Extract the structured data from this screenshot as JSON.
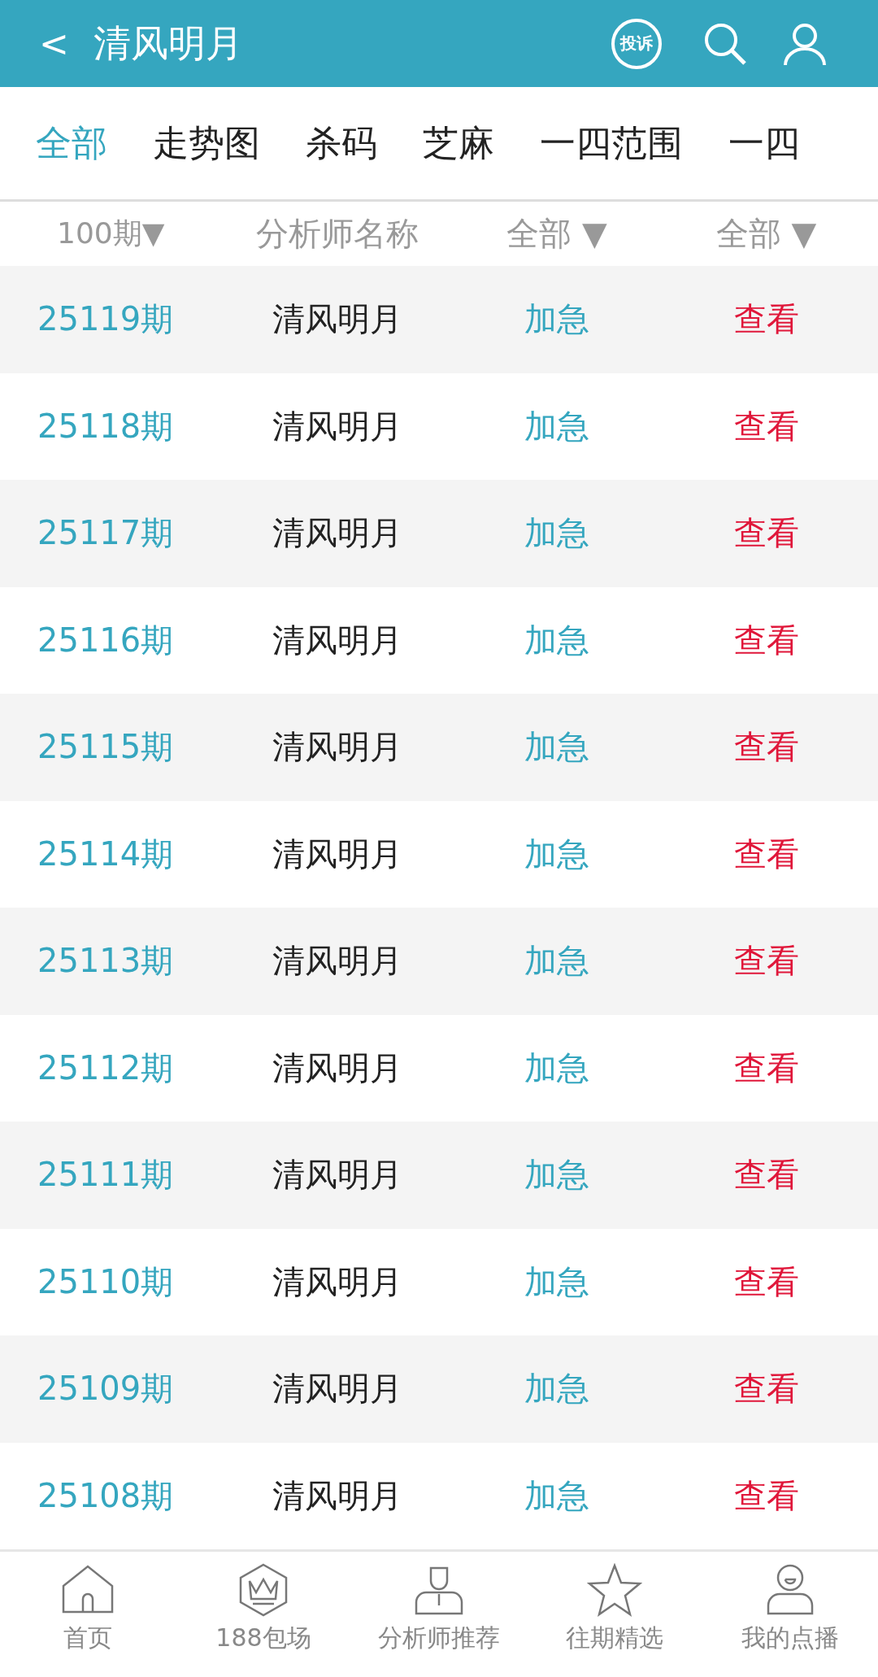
{
  "header": {
    "back": "<",
    "title": "清风明月",
    "complaint": "投诉"
  },
  "tabs": [
    {
      "label": "全部",
      "selected": true
    },
    {
      "label": "走势图",
      "selected": false
    },
    {
      "label": "杀码",
      "selected": false
    },
    {
      "label": "芝麻",
      "selected": false
    },
    {
      "label": "一四范围",
      "selected": false
    },
    {
      "label": "一四",
      "selected": false
    }
  ],
  "table": {
    "columns": [
      "100期▼",
      "分析师名称",
      "全部 ▼",
      "全部 ▼"
    ],
    "rows": [
      {
        "period": "25119期",
        "analyst": "清风明月",
        "status": "加急",
        "action": "查看"
      },
      {
        "period": "25118期",
        "analyst": "清风明月",
        "status": "加急",
        "action": "查看"
      },
      {
        "period": "25117期",
        "analyst": "清风明月",
        "status": "加急",
        "action": "查看"
      },
      {
        "period": "25116期",
        "analyst": "清风明月",
        "status": "加急",
        "action": "查看"
      },
      {
        "period": "25115期",
        "analyst": "清风明月",
        "status": "加急",
        "action": "查看"
      },
      {
        "period": "25114期",
        "analyst": "清风明月",
        "status": "加急",
        "action": "查看"
      },
      {
        "period": "25113期",
        "analyst": "清风明月",
        "status": "加急",
        "action": "查看"
      },
      {
        "period": "25112期",
        "analyst": "清风明月",
        "status": "加急",
        "action": "查看"
      },
      {
        "period": "25111期",
        "analyst": "清风明月",
        "status": "加急",
        "action": "查看"
      },
      {
        "period": "25110期",
        "analyst": "清风明月",
        "status": "加急",
        "action": "查看"
      },
      {
        "period": "25109期",
        "analyst": "清风明月",
        "status": "加急",
        "action": "查看"
      },
      {
        "period": "25108期",
        "analyst": "清风明月",
        "status": "加急",
        "action": "查看"
      }
    ]
  },
  "bottom_nav": [
    {
      "kind": "home",
      "label": "首页"
    },
    {
      "kind": "crown",
      "label": "188包场"
    },
    {
      "kind": "analyst",
      "label": "分析师推荐"
    },
    {
      "kind": "star",
      "label": "往期精选"
    },
    {
      "kind": "user",
      "label": "我的点播"
    }
  ]
}
